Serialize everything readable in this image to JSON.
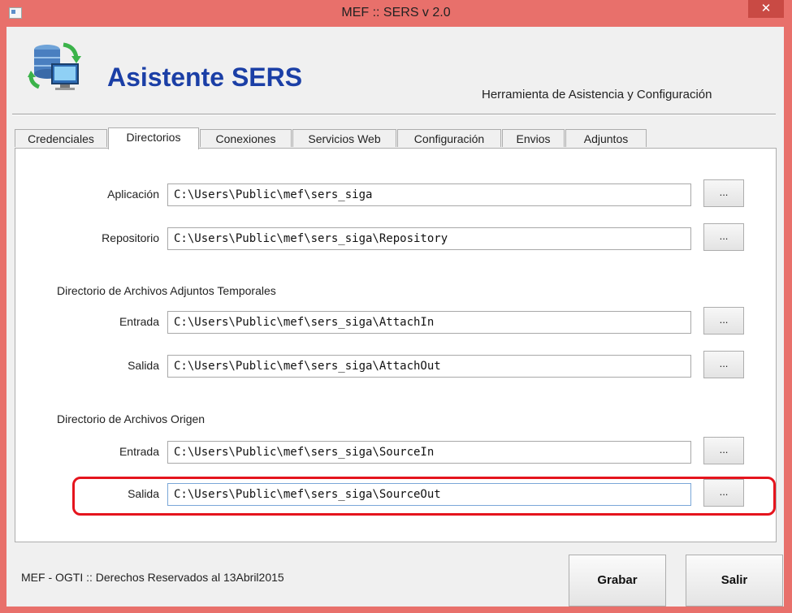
{
  "window": {
    "title": "MEF :: SERS v 2.0",
    "close_glyph": "✕"
  },
  "header": {
    "title": "Asistente SERS",
    "subtitle": "Herramienta de Asistencia y Configuración",
    "logo_icon": "database-sync-icon"
  },
  "tabs": [
    {
      "label": "Credenciales",
      "active": false
    },
    {
      "label": "Directorios",
      "active": true
    },
    {
      "label": "Conexiones",
      "active": false
    },
    {
      "label": "Servicios Web",
      "active": false
    },
    {
      "label": "Configuración",
      "active": false
    },
    {
      "label": "Envios",
      "active": false
    },
    {
      "label": "Adjuntos",
      "active": false
    }
  ],
  "directorios": {
    "aplicacion": {
      "label": "Aplicación",
      "value": "C:\\Users\\Public\\mef\\sers_siga"
    },
    "repositorio": {
      "label": "Repositorio",
      "value": "C:\\Users\\Public\\mef\\sers_siga\\Repository"
    },
    "adjuntos_section": "Directorio de Archivos Adjuntos Temporales",
    "adjuntos_entrada": {
      "label": "Entrada",
      "value": "C:\\Users\\Public\\mef\\sers_siga\\AttachIn"
    },
    "adjuntos_salida": {
      "label": "Salida",
      "value": "C:\\Users\\Public\\mef\\sers_siga\\AttachOut"
    },
    "origen_section": "Directorio de Archivos Origen",
    "origen_entrada": {
      "label": "Entrada",
      "value": "C:\\Users\\Public\\mef\\sers_siga\\SourceIn"
    },
    "origen_salida": {
      "label": "Salida",
      "value": "C:\\Users\\Public\\mef\\sers_siga\\SourceOut"
    },
    "browse_label": "..."
  },
  "footer": {
    "copyright": "MEF - OGTI :: Derechos Reservados al 13Abril2015",
    "save_label": "Grabar",
    "exit_label": "Salir"
  },
  "colors": {
    "titlebar": "#e8706b",
    "highlight": "#e5141d",
    "header_title": "#1b3fa6"
  }
}
